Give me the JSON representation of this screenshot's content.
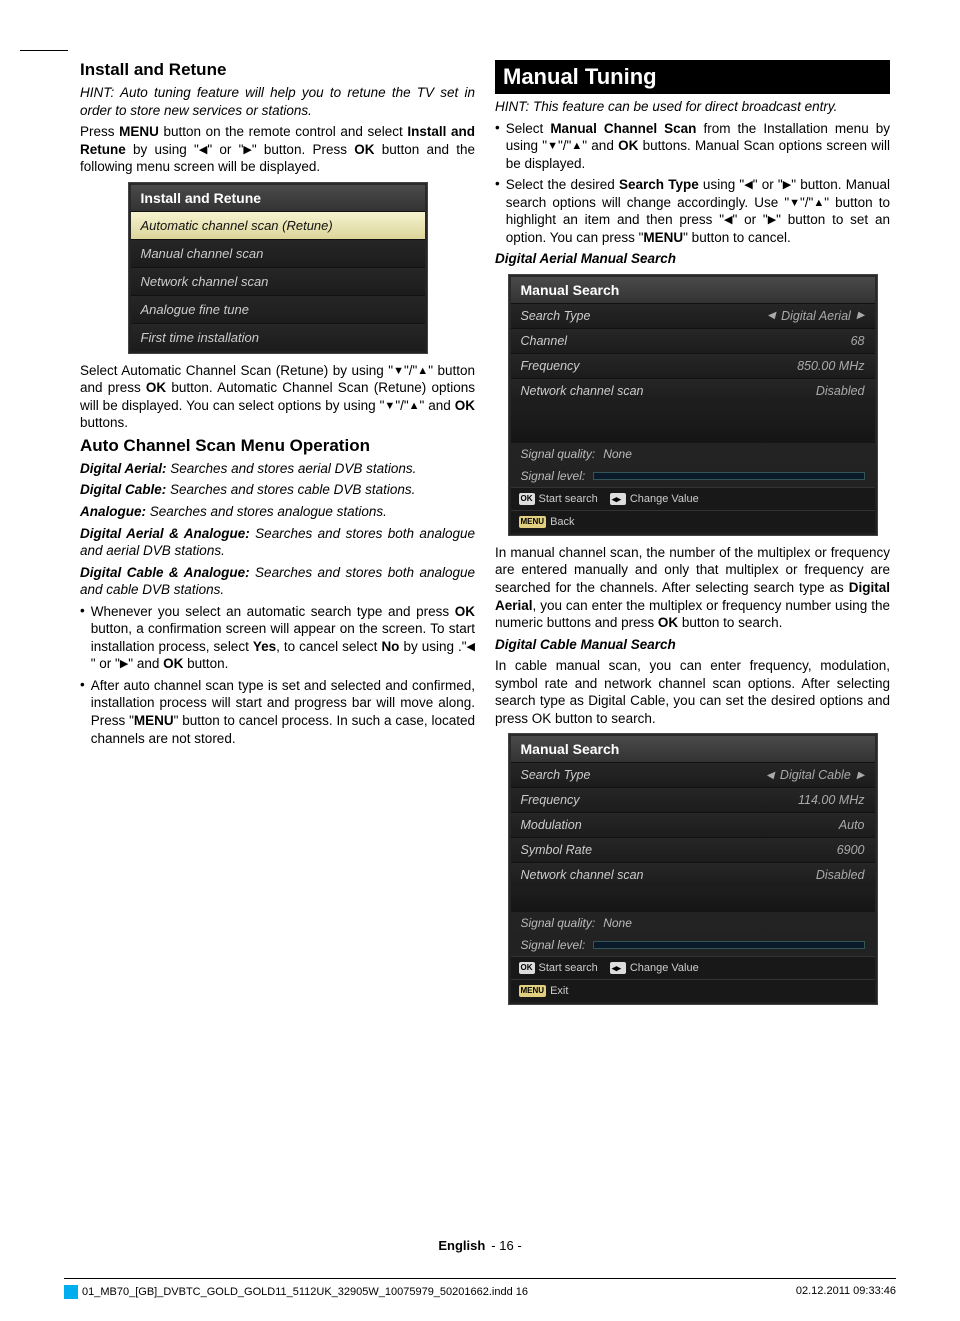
{
  "page": {
    "lang": "English",
    "num": "16"
  },
  "meta": {
    "file": "01_MB70_[GB]_DVBTC_GOLD_GOLD11_5112UK_32905W_10075979_50201662.indd   16",
    "date": "02.12.2011   09:33:46"
  },
  "tri": {
    "left": "◀",
    "right": "▶",
    "down": "▼",
    "up": "▲"
  },
  "left": {
    "h1": "Install and Retune",
    "hint": "HINT: Auto tuning feature will help you to retune the TV set in order to store new services or stations.",
    "p1a": "Press ",
    "p1b": "MENU",
    "p1c": " button on the remote control and select ",
    "p1d": "Install and Retune",
    "p1e": " by using \"",
    "p1f": "\" or \"",
    "p1g": "\" button. Press ",
    "p1h": "OK",
    "p1i": " button and the following menu screen will be displayed.",
    "menu1": {
      "title": "Install and Retune",
      "items": [
        "Automatic channel scan (Retune)",
        "Manual channel scan",
        "Network channel scan",
        "Analogue fine tune",
        "First time installation"
      ]
    },
    "p2a": "Select Automatic Channel Scan (Retune) by using \"",
    "p2b": "\"/\"",
    "p2c": "\" button and press ",
    "p2d": "OK",
    "p2e": " button. Automatic Channel Scan (Retune) options will be displayed. You can select options by using \"",
    "p2f": "\"/\"",
    "p2g": "\" and ",
    "p2h": "OK",
    "p2i": " buttons.",
    "h2": "Auto Channel Scan Menu Operation",
    "da_l": "Digital Aerial:",
    "da_t": " Searches and stores aerial DVB stations.",
    "dc_l": "Digital Cable:",
    "dc_t": " Searches and stores cable DVB stations.",
    "an_l": "Analogue:",
    "an_t": " Searches and stores analogue stations.",
    "daa_l": "Digital Aerial & Analogue:",
    "daa_t": " Searches and stores both analogue and aerial DVB stations.",
    "dca_l": "Digital Cable & Analogue:",
    "dca_t": " Searches and stores both analogue and cable DVB stations.",
    "b1a": "Whenever you select an automatic search type and press ",
    "b1b": "OK",
    "b1c": " button, a confirmation screen will appear on the screen. To start installation process, select ",
    "b1d": "Yes",
    "b1e": ", to cancel select ",
    "b1f": "No",
    "b1g": " by using .\"",
    "b1h": "\" or \"",
    "b1i": "\" and ",
    "b1j": "OK",
    "b1k": " button.",
    "b2a": "After auto channel scan type is set and selected and confirmed, installation process will start and progress bar will move along. Press \"",
    "b2b": "MENU",
    "b2c": "\" button to cancel process. In such a case, located channels are not stored."
  },
  "right": {
    "h1": "Manual Tuning",
    "hint": "HINT: This feature can be used for direct broadcast entry.",
    "b1a": "Select ",
    "b1b": "Manual Channel Scan",
    "b1c": " from the Installation menu by using \"",
    "b1d": "\"/\"",
    "b1e": "\" and ",
    "b1f": "OK",
    "b1g": " buttons. Manual Scan options screen will be displayed.",
    "b2a": "Select the desired ",
    "b2b": "Search Type",
    "b2c": " using \"",
    "b2d": "\" or \"",
    "b2e": "\" button. Manual search options will change accordingly. Use \"",
    "b2f": "\"/\"",
    "b2g": "\" button to highlight an item and then press \"",
    "b2h": "\" or \"",
    "b2i": "\" button to set an option. You can press \"",
    "b2j": "MENU",
    "b2k": "\" button to cancel.",
    "h_dams": "Digital Aerial Manual Search",
    "menu2": {
      "title": "Manual Search",
      "rows": [
        {
          "label": "Search Type",
          "value": "Digital Aerial",
          "arrows": true
        },
        {
          "label": "Channel",
          "value": "68"
        },
        {
          "label": "Frequency",
          "value": "850.00 MHz"
        },
        {
          "label": "Network channel scan",
          "value": "Disabled"
        }
      ],
      "sig1": "Signal quality:",
      "sigv1": "None",
      "sig2": "Signal level:",
      "btn_ok": "Start search",
      "btn_arrows": "Change Value",
      "btn_menu": "Back"
    },
    "p3": "In manual channel scan, the number of the multiplex or frequency are entered manually and only that multiplex or frequency are searched for the channels. After selecting search type as ",
    "p3b": "Digital Aerial",
    "p3c": ", you can enter the multiplex or frequency number using the numeric buttons and press ",
    "p3d": "OK",
    "p3e": " button to search.",
    "h_dcms": "Digital Cable Manual Search",
    "p4": "In cable manual scan, you can enter frequency, modulation, symbol rate and network channel scan options. After selecting search type as Digital Cable, you can set the desired options and press OK button to search.",
    "menu3": {
      "title": "Manual Search",
      "rows": [
        {
          "label": "Search Type",
          "value": "Digital Cable",
          "arrows": true
        },
        {
          "label": "Frequency",
          "value": "114.00 MHz"
        },
        {
          "label": "Modulation",
          "value": "Auto"
        },
        {
          "label": "Symbol Rate",
          "value": "6900"
        },
        {
          "label": "Network channel scan",
          "value": "Disabled"
        }
      ],
      "sig1": "Signal quality:",
      "sigv1": "None",
      "sig2": "Signal level:",
      "btn_ok": "Start search",
      "btn_arrows": "Change Value",
      "btn_menu": "Exit"
    }
  }
}
